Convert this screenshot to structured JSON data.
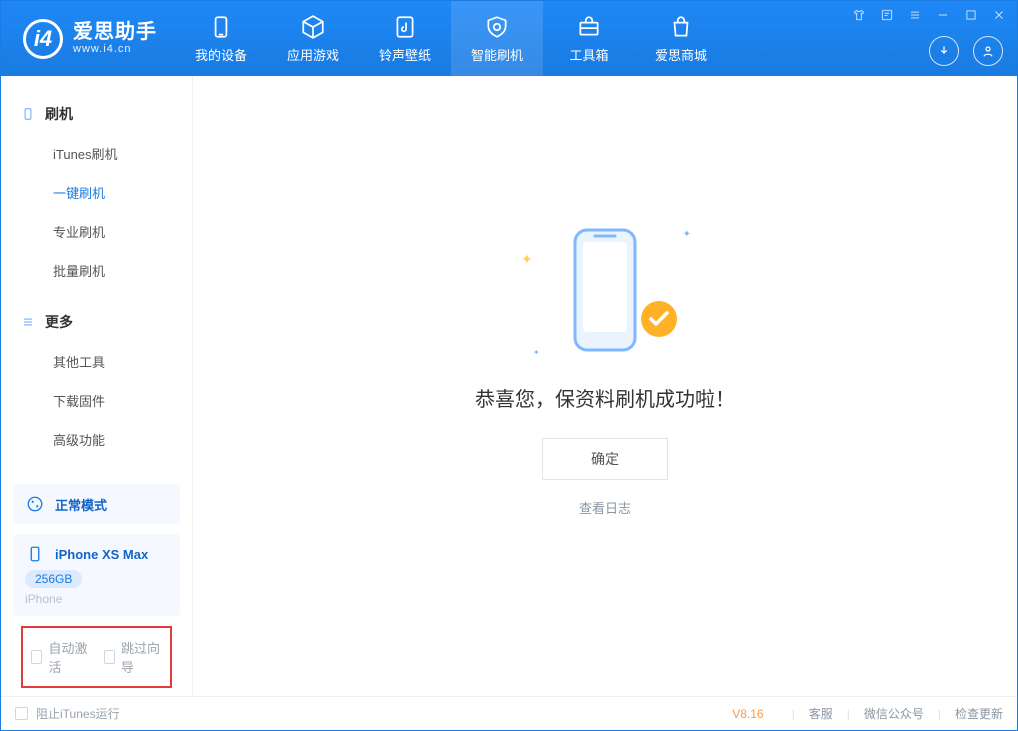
{
  "app": {
    "name_cn": "爱思助手",
    "name_en": "www.i4.cn"
  },
  "nav": {
    "items": [
      {
        "label": "我的设备"
      },
      {
        "label": "应用游戏"
      },
      {
        "label": "铃声壁纸"
      },
      {
        "label": "智能刷机"
      },
      {
        "label": "工具箱"
      },
      {
        "label": "爱思商城"
      }
    ],
    "active_index": 3
  },
  "sidebar": {
    "groups": [
      {
        "title": "刷机",
        "icon": "device",
        "items": [
          {
            "label": "iTunes刷机"
          },
          {
            "label": "一键刷机"
          },
          {
            "label": "专业刷机"
          },
          {
            "label": "批量刷机"
          }
        ],
        "active_index": 1
      },
      {
        "title": "更多",
        "icon": "menu",
        "items": [
          {
            "label": "其他工具"
          },
          {
            "label": "下载固件"
          },
          {
            "label": "高级功能"
          }
        ],
        "active_index": -1
      }
    ],
    "mode_card": {
      "label": "正常模式"
    },
    "device_card": {
      "name": "iPhone XS Max",
      "storage": "256GB",
      "type": "iPhone"
    },
    "checks": {
      "auto_activate": "自动激活",
      "skip_guide": "跳过向导"
    }
  },
  "main": {
    "message": "恭喜您，保资料刷机成功啦！",
    "ok": "确定",
    "log_link": "查看日志"
  },
  "footer": {
    "block_itunes": "阻止iTunes运行",
    "version": "V8.16",
    "links": {
      "service": "客服",
      "wechat": "微信公众号",
      "update": "检查更新"
    }
  }
}
